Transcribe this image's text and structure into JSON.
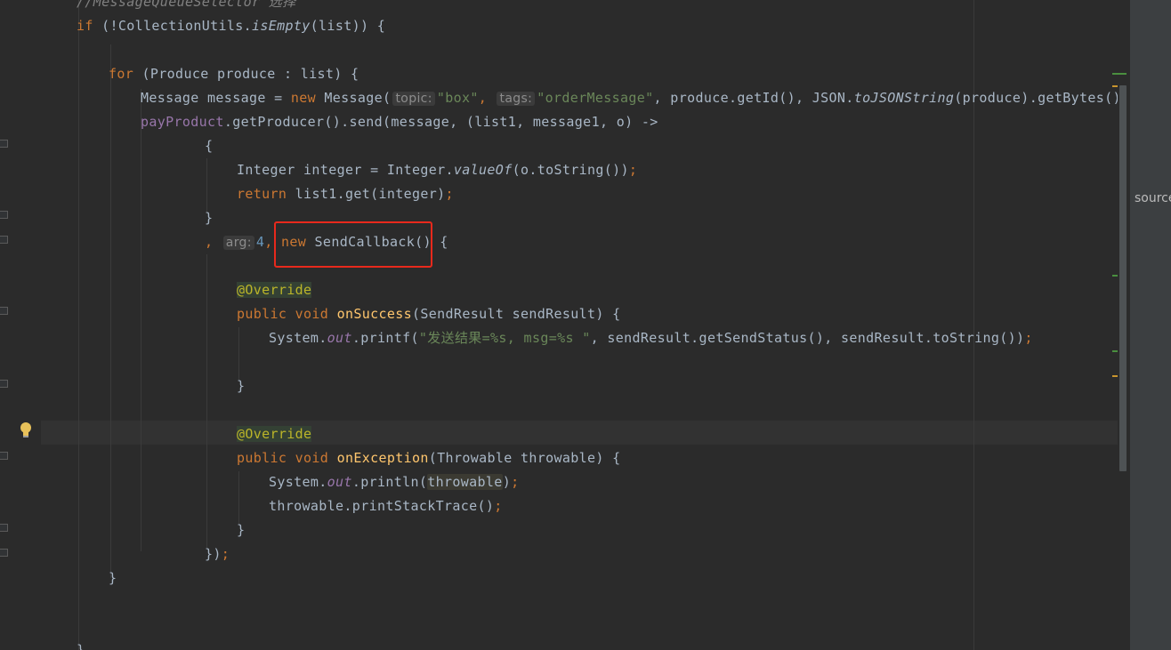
{
  "editor": {
    "lines": {
      "l0_comment": "//MessageQueueSelector 选择",
      "l1_kw_if": "if",
      "l1_rest_a": " (!CollectionUtils.",
      "l1_isEmpty": "isEmpty",
      "l1_rest_b": "(list)) {",
      "l3_kw_for": "for",
      "l3_rest": " (Produce produce : list) {",
      "l4_a": "Message message = ",
      "l4_kw_new": "new",
      "l4_b": " Message(",
      "l4_hint_topic": "topic:",
      "l4_str_box": "\"box\"",
      "l4_comma1": ", ",
      "l4_hint_tags": "tags:",
      "l4_str_order": "\"orderMessage\"",
      "l4_c": ", produce.getId(), JSON.",
      "l4_tojson": "toJSONString",
      "l4_d": "(produce).getBytes())",
      "l4_semi": ";",
      "l5_field": "payProduct",
      "l5_rest": ".getProducer().send(message, (list1, message1, o) ->",
      "l6": "{",
      "l7_a": "Integer integer = Integer.",
      "l7_valueof": "valueOf",
      "l7_b": "(o.toString())",
      "l7_semi": ";",
      "l8_kw_return": "return",
      "l8_rest": " list1.get(integer)",
      "l8_semi": ";",
      "l9": "}",
      "l10_comma": ", ",
      "l10_hint_arg": "arg:",
      "l10_num": "4",
      "l10_comma2": ", ",
      "l10_kw_new": "new",
      "l10_rest": " SendCallback() {",
      "l12_override": "@Override",
      "l13_kw": "public void",
      "l13_fn": "onSuccess",
      "l13_rest": "(SendResult sendResult) {",
      "l14_a": "System.",
      "l14_out": "out",
      "l14_b": ".printf(",
      "l14_str": "\"发送结果=%s, msg=%s \"",
      "l14_c": ", sendResult.getSendStatus(), sendResult.toString())",
      "l14_semi": ";",
      "l16": "}",
      "l18_override": "@Override",
      "l19_kw": "public void",
      "l19_fn": "onException",
      "l19_rest": "(Throwable throwable) {",
      "l20_a": "System.",
      "l20_out": "out",
      "l20_b": ".println(",
      "l20_usage": "throwable",
      "l20_c": ")",
      "l20_semi": ";",
      "l21_a": "throwable.printStackTrace()",
      "l21_semi": ";",
      "l22": "}",
      "l23_a": "})",
      "l23_semi": ";",
      "l24": "}",
      "l27": "}"
    }
  },
  "right_panel": {
    "label": "source"
  },
  "icons": {
    "bulb": "lightbulb-icon"
  },
  "colors": {
    "background": "#2b2b2b",
    "keyword": "#cc7832",
    "string": "#6a8759",
    "field": "#9876aa",
    "method": "#ffc66d",
    "annotation": "#bbb529",
    "highlight_box": "#e8291c"
  }
}
